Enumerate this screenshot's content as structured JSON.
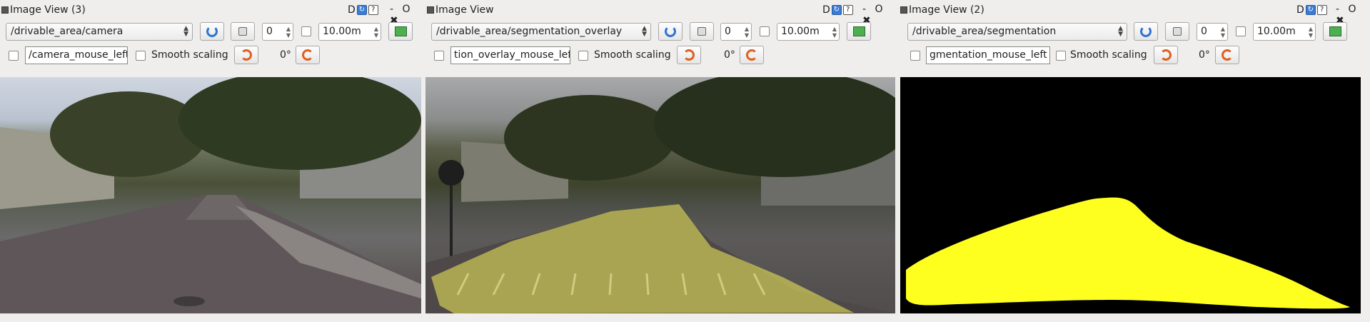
{
  "panels": [
    {
      "title": "Image View (3)",
      "title_buttons": [
        "D",
        "?"
      ],
      "window_controls": "- O ✖",
      "topic": "/drivable_area/camera",
      "frame_value": "0",
      "zoom_value": "10.00m",
      "mouse_topic": "/camera_mouse_left",
      "smooth_label": "Smooth scaling",
      "rotation": "0°"
    },
    {
      "title": "Image View",
      "title_buttons": [
        "D",
        "?"
      ],
      "window_controls": "- O ✖",
      "topic": "/drivable_area/segmentation_overlay",
      "frame_value": "0",
      "zoom_value": "10.00m",
      "mouse_topic": "tion_overlay_mouse_left",
      "smooth_label": "Smooth scaling",
      "rotation": "0°"
    },
    {
      "title": "Image View (2)",
      "title_buttons": [
        "D",
        "?"
      ],
      "window_controls": "- O ✖",
      "topic": "/drivable_area/segmentation",
      "frame_value": "0",
      "zoom_value": "10.00m",
      "mouse_topic": "gmentation_mouse_left",
      "smooth_label": "Smooth scaling",
      "rotation": "0°"
    }
  ],
  "colors": {
    "overlay_yellow": "#f4f05a",
    "segmentation_yellow": "#ffff1f",
    "refresh_blue": "#2f74d0",
    "rotate_orange": "#e0601e"
  },
  "icons": [
    "window-icon",
    "refresh-icon",
    "stop-icon",
    "save-icon",
    "rotate-left-icon",
    "rotate-right-icon",
    "chevron-down-icon"
  ]
}
